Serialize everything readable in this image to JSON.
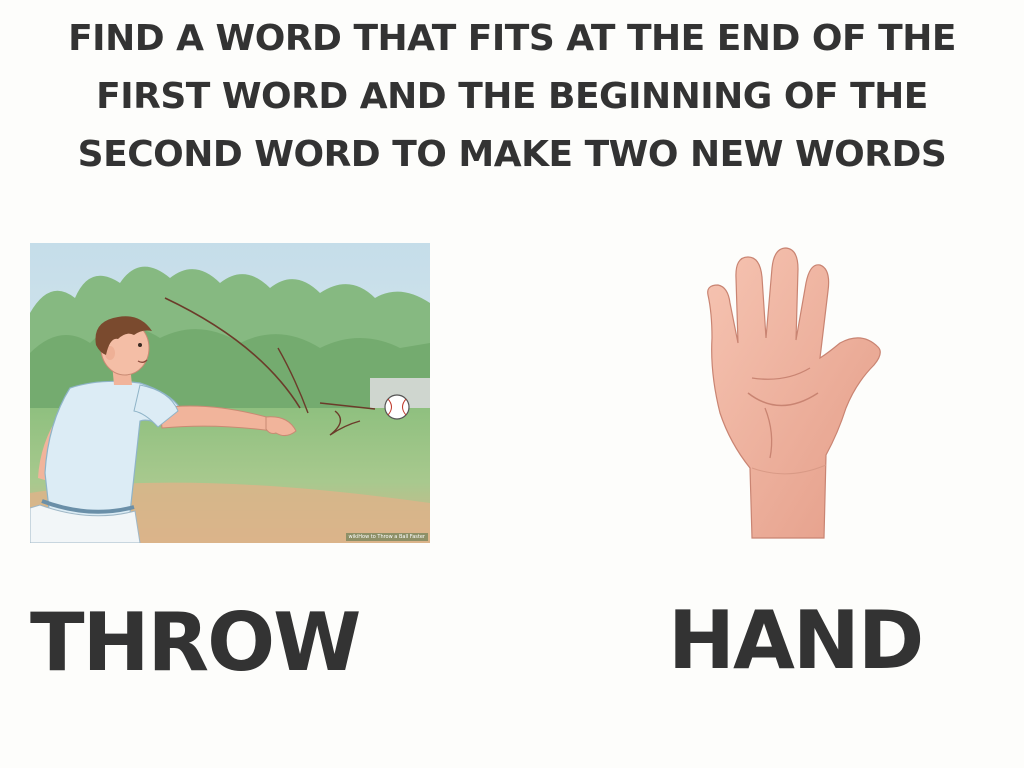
{
  "instruction": {
    "line1": "FIND A WORD THAT FITS AT THE END OF THE",
    "line2": "FIRST WORD AND THE BEGINNING OF THE",
    "line3": "SECOND WORD TO MAKE TWO NEW WORDS"
  },
  "left_panel": {
    "word": "THROW",
    "image_icon": "boy-throwing-baseball-illustration",
    "watermark": "wikiHow to Throw a Ball Faster"
  },
  "right_panel": {
    "word": "HAND",
    "image_icon": "open-palm-hand-illustration"
  },
  "colors": {
    "text": "#333333",
    "background": "#fdfdfb",
    "sky": "#cfe3ee",
    "trees": "#7fb27a",
    "grass": "#9cc48a",
    "dirt": "#d9b48a",
    "shirt": "#dfeef6",
    "hair": "#7a4a2e",
    "skin": "#f2b8a0"
  }
}
